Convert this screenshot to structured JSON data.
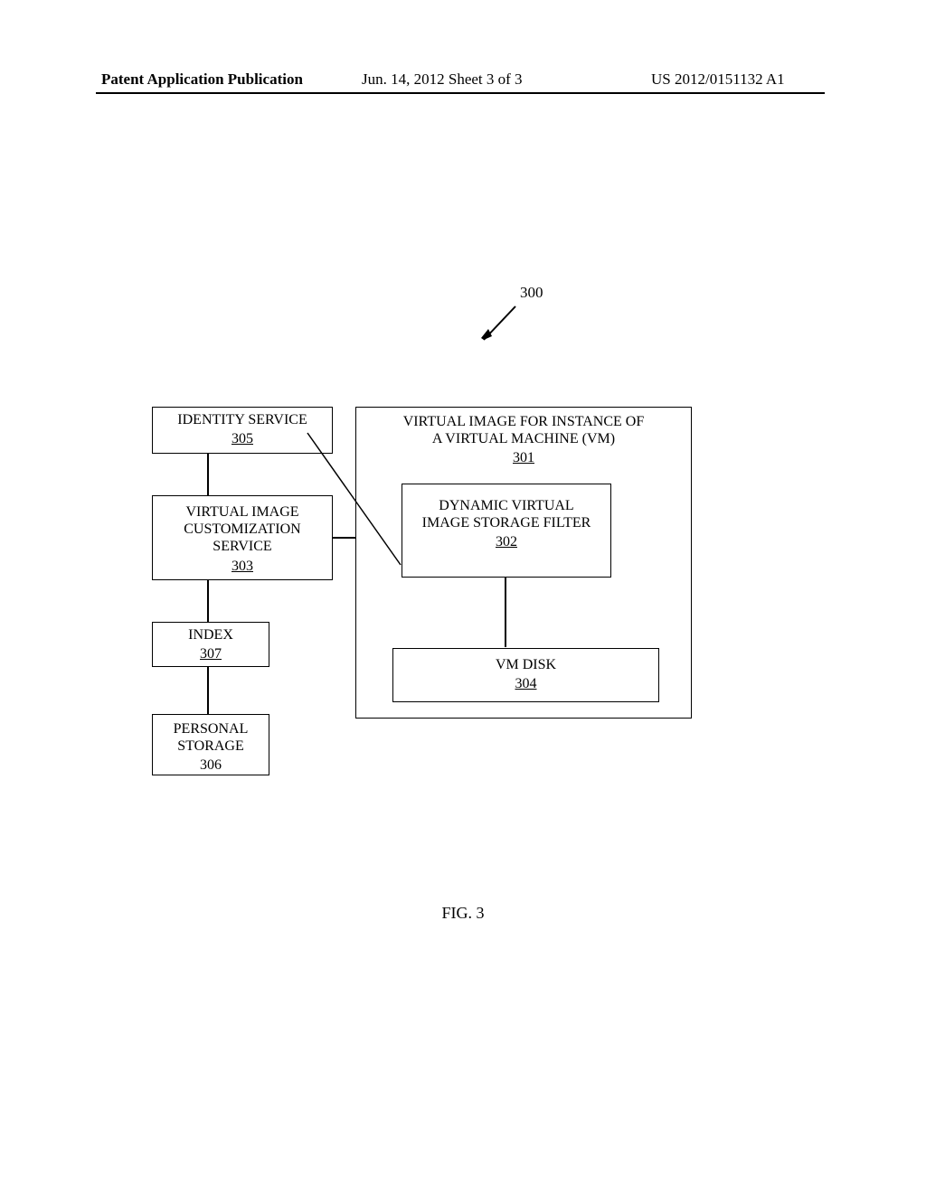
{
  "header": {
    "left": "Patent Application Publication",
    "center": "Jun. 14, 2012  Sheet 3 of 3",
    "right": "US 2012/0151132 A1"
  },
  "reference_label": "300",
  "boxes": {
    "identity_service": {
      "title": "IDENTITY SERVICE",
      "num": "305"
    },
    "customization": {
      "title_l1": "VIRTUAL IMAGE",
      "title_l2": "CUSTOMIZATION",
      "title_l3": "SERVICE",
      "num": "303"
    },
    "index": {
      "title": "INDEX",
      "num": "307"
    },
    "personal_storage": {
      "title_l1": "PERSONAL",
      "title_l2": "STORAGE",
      "num": "306"
    },
    "vm_image": {
      "title_l1": "VIRTUAL IMAGE FOR INSTANCE OF",
      "title_l2": "A VIRTUAL MACHINE (VM)",
      "num": "301"
    },
    "filter": {
      "title_l1": "DYNAMIC VIRTUAL",
      "title_l2": "IMAGE STORAGE FILTER",
      "num": "302"
    },
    "vm_disk": {
      "title": "VM DISK",
      "num": "304"
    }
  },
  "caption": "FIG. 3"
}
